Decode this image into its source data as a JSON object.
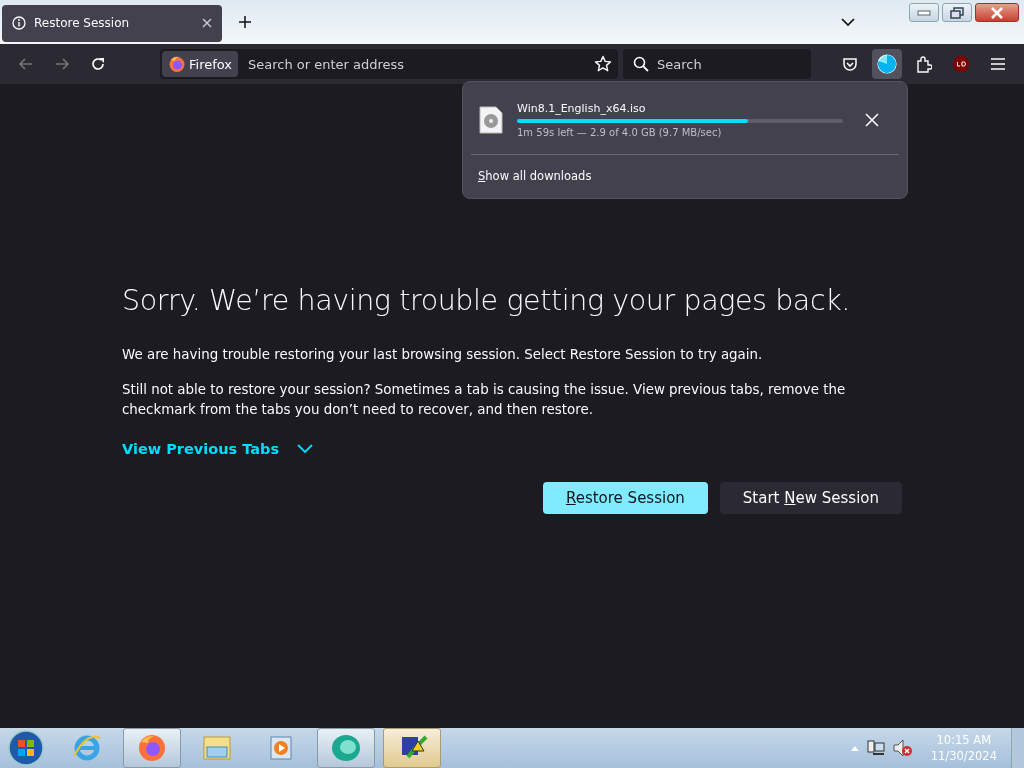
{
  "tab": {
    "title": "Restore Session",
    "selected": true
  },
  "toolbar": {
    "identity": "Firefox",
    "address_placeholder": "Search or enter address",
    "search_placeholder": "Search"
  },
  "downloads_panel": {
    "file_name": "Win8.1_English_x64.iso",
    "level": 0.71,
    "status": "1m 59s left — 2.9 of 4.0 GB (9.7 MB/sec)",
    "show_all": {
      "label": [
        {
          "text": "S",
          "underline": true
        },
        {
          "text": "how all downloads",
          "underline": false
        }
      ]
    }
  },
  "page": {
    "heading": "Sorry. We’re having trouble getting your pages back.",
    "paragraphs": [
      "We are having trouble restoring your last browsing session. Select Restore Session to try again.",
      "Still not able to restore your session? Sometimes a tab is causing the issue. View previous tabs, remove the checkmark from the tabs you don’t need to recover, and then restore."
    ],
    "view_previous": {
      "label": "View Previous Tabs",
      "expanded": false
    },
    "buttons": [
      {
        "label": [
          {
            "text": "R",
            "underline": true
          },
          {
            "text": "estore Session",
            "underline": false
          }
        ],
        "kind": "primary"
      },
      {
        "label": [
          {
            "text": "Start ",
            "underline": false
          },
          {
            "text": "N",
            "underline": true
          },
          {
            "text": "ew Session",
            "underline": false
          }
        ],
        "kind": "secondary"
      }
    ]
  },
  "taskbar": {
    "time": "10:15 AM",
    "date": "11/30/2024"
  }
}
